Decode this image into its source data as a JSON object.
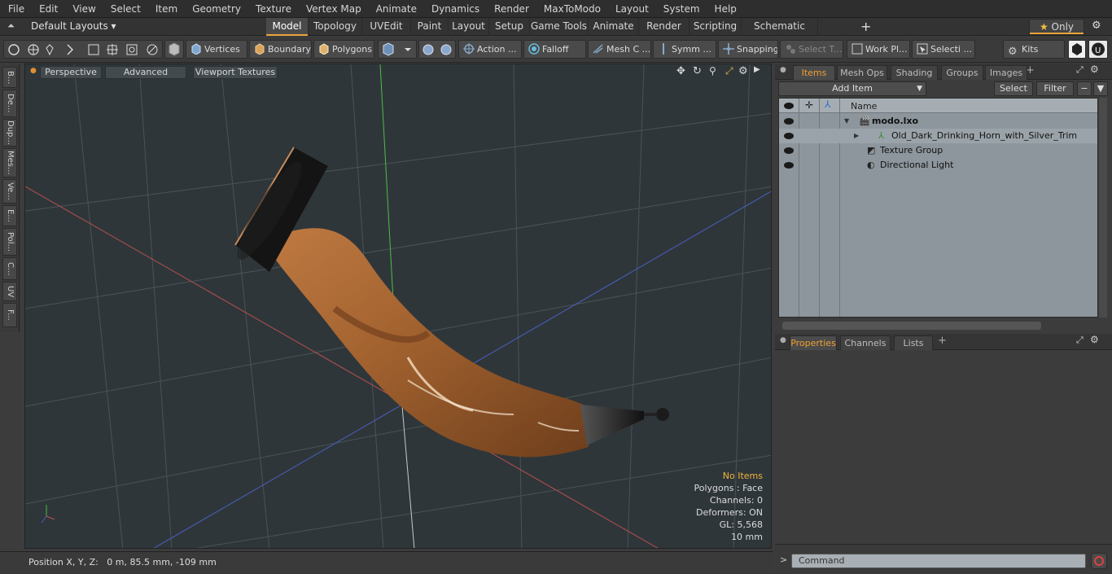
{
  "menu": [
    "File",
    "Edit",
    "View",
    "Select",
    "Item",
    "Geometry",
    "Texture",
    "Vertex Map",
    "Animate",
    "Dynamics",
    "Render",
    "MaxToModo",
    "Layout",
    "System",
    "Help"
  ],
  "layoutbar": {
    "preset": "Default Layouts ▾",
    "tabs": [
      "Model",
      "Topology",
      "UVEdit",
      "Paint",
      "Layout",
      "Setup",
      "Game Tools",
      "Animate",
      "Render",
      "Scripting",
      "Schematic Fusion"
    ],
    "add": "+",
    "only": "Only"
  },
  "toolbar": {
    "vertices": "Vertices",
    "boundary": "Boundary",
    "polygons": "Polygons",
    "action": "Action ...",
    "falloff": "Falloff",
    "mesh": "Mesh C ...",
    "symm": "Symm ...",
    "snapping": "Snapping",
    "select_t": "Select T...",
    "workplane": "Work Pl...",
    "selecti": "Selecti ...",
    "kits": "Kits"
  },
  "left_tabs": [
    "B...",
    "De...",
    "Dup...",
    "Mes...",
    "Ve...",
    "E...",
    "Pol...",
    "C...",
    "UV",
    "F..."
  ],
  "viewport": {
    "perspective": "Perspective",
    "advanced": "Advanced",
    "textures": "Viewport Textures",
    "info": {
      "no_items": "No Items",
      "polygons": "Polygons : Face",
      "channels": "Channels: 0",
      "deformers": "Deformers: ON",
      "gl": "GL: 5,568",
      "scale": "10 mm"
    }
  },
  "status": {
    "position": "Position X, Y, Z:   0 m, 85.5 mm, -109 mm"
  },
  "items_panel": {
    "tabs": [
      "Items",
      "Mesh Ops",
      "Shading",
      "Groups",
      "Images"
    ],
    "add_item": "Add Item",
    "select": "Select",
    "filter": "Filter",
    "name_header": "Name",
    "rows": [
      {
        "label": "modo.lxo",
        "bold": true
      },
      {
        "label": "Old_Dark_Drinking_Horn_with_Silver_Trim",
        "bold": false
      },
      {
        "label": "Texture Group",
        "bold": false
      },
      {
        "label": "Directional Light",
        "bold": false
      }
    ]
  },
  "properties_panel": {
    "tabs": [
      "Properties",
      "Channels",
      "Lists"
    ]
  },
  "command": {
    "placeholder": "Command"
  },
  "colors": {
    "accent": "#f0a030",
    "horn": "#a2622f",
    "metal": "#1c1c1c"
  }
}
